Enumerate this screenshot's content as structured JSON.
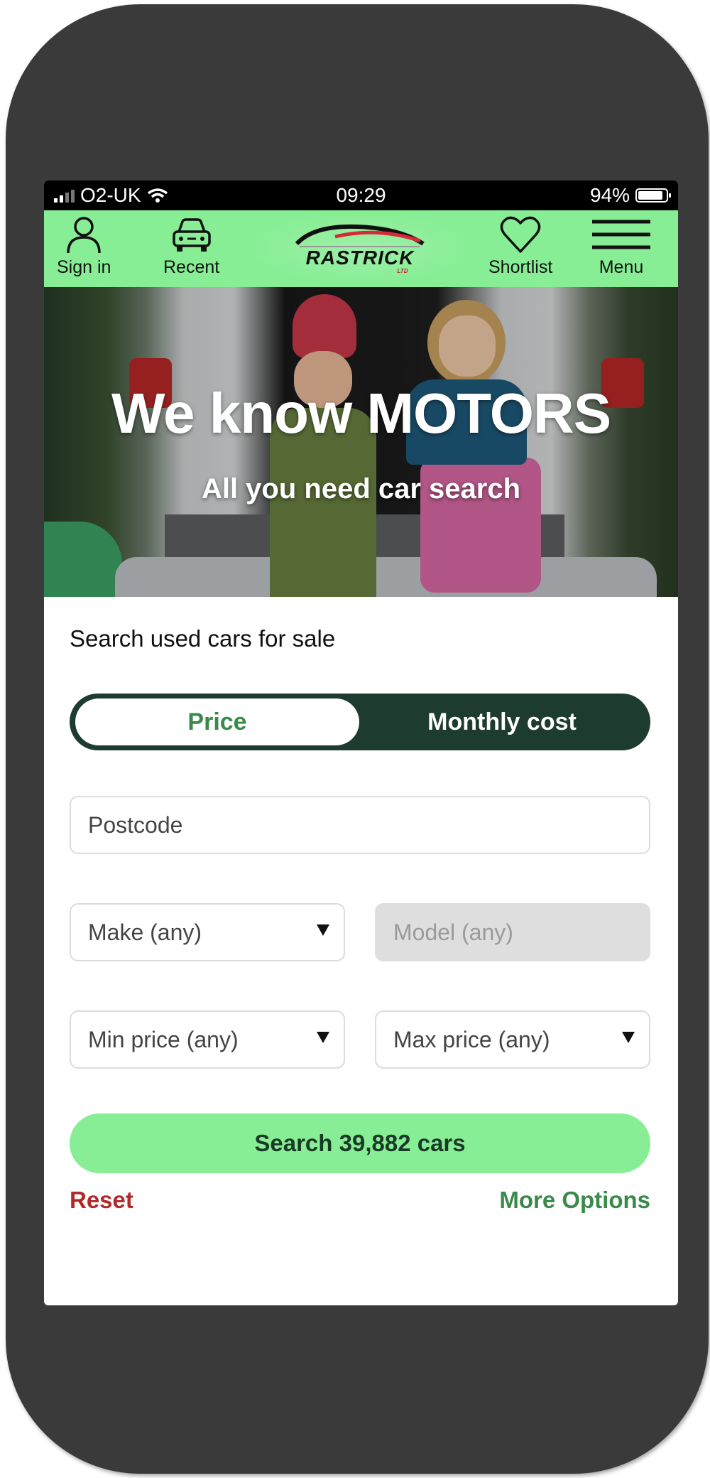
{
  "status_bar": {
    "carrier": "O2-UK",
    "time": "09:29",
    "battery": "94%"
  },
  "nav": {
    "sign_in": "Sign in",
    "recent": "Recent",
    "shortlist": "Shortlist",
    "menu": "Menu",
    "logo_text": "RASTRICK",
    "logo_sub": "LTD"
  },
  "hero": {
    "title": "We know MOTORS",
    "subtitle": "All you need car search"
  },
  "search": {
    "heading": "Search used cars for sale",
    "toggle_active": "Price",
    "toggle_inactive": "Monthly cost",
    "postcode_placeholder": "Postcode",
    "make": "Make (any)",
    "model": "Model (any)",
    "min_price": "Min price (any)",
    "max_price": "Max price (any)",
    "search_button": "Search  39,882 cars",
    "reset": "Reset",
    "more_options": "More Options"
  },
  "colors": {
    "brand_green": "#88ee95",
    "dark_green": "#1e3b30",
    "accent_green_text": "#3a8a4a",
    "reset_red": "#b02a2a"
  }
}
